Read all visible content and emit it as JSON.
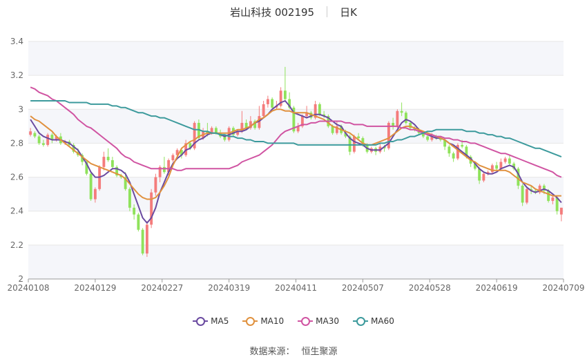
{
  "header": {
    "title": "岩山科技 002195",
    "period": "日K"
  },
  "source": {
    "label": "数据来源：",
    "name": "恒生聚源"
  },
  "colors": {
    "up": "#f47c7c",
    "down": "#8fe25b",
    "band": "#f5f6fa",
    "grid": "#e6e6e6",
    "ma5": "#6a4aa0",
    "ma10": "#e0913e",
    "ma30": "#d054a2",
    "ma60": "#3c9a9c"
  },
  "chart_data": {
    "type": "candlestick",
    "title": "岩山科技 002195",
    "ylim": [
      2,
      3.4
    ],
    "y_ticks": [
      "2",
      "2.2",
      "2.4",
      "2.6",
      "2.8",
      "3",
      "3.2",
      "3.4"
    ],
    "x_ticks": [
      "20240108",
      "20240129",
      "20240227",
      "20240319",
      "20240411",
      "20240507",
      "20240528",
      "20240619",
      "20240709"
    ],
    "n_days": 124,
    "candles": [
      [
        2.85,
        2.87,
        2.84,
        2.89
      ],
      [
        2.86,
        2.84,
        2.83,
        2.87
      ],
      [
        2.84,
        2.8,
        2.79,
        2.85
      ],
      [
        2.8,
        2.79,
        2.78,
        2.82
      ],
      [
        2.79,
        2.85,
        2.78,
        2.86
      ],
      [
        2.85,
        2.82,
        2.8,
        2.86
      ],
      [
        2.82,
        2.84,
        2.81,
        2.85
      ],
      [
        2.84,
        2.8,
        2.79,
        2.86
      ],
      [
        2.8,
        2.81,
        2.79,
        2.82
      ],
      [
        2.81,
        2.79,
        2.78,
        2.82
      ],
      [
        2.79,
        2.75,
        2.74,
        2.8
      ],
      [
        2.75,
        2.73,
        2.72,
        2.77
      ],
      [
        2.73,
        2.69,
        2.67,
        2.74
      ],
      [
        2.69,
        2.62,
        2.61,
        2.7
      ],
      [
        2.62,
        2.47,
        2.46,
        2.63
      ],
      [
        2.47,
        2.53,
        2.45,
        2.54
      ],
      [
        2.53,
        2.66,
        2.52,
        2.67
      ],
      [
        2.66,
        2.72,
        2.64,
        2.75
      ],
      [
        2.72,
        2.7,
        2.69,
        2.77
      ],
      [
        2.7,
        2.66,
        2.65,
        2.72
      ],
      [
        2.66,
        2.61,
        2.6,
        2.67
      ],
      [
        2.61,
        2.6,
        2.59,
        2.62
      ],
      [
        2.6,
        2.53,
        2.52,
        2.63
      ],
      [
        2.53,
        2.42,
        2.4,
        2.54
      ],
      [
        2.42,
        2.38,
        2.35,
        2.44
      ],
      [
        2.38,
        2.29,
        2.28,
        2.39
      ],
      [
        2.29,
        2.15,
        2.14,
        2.3
      ],
      [
        2.15,
        2.32,
        2.13,
        2.34
      ],
      [
        2.32,
        2.51,
        2.3,
        2.53
      ],
      [
        2.51,
        2.6,
        2.49,
        2.62
      ],
      [
        2.6,
        2.66,
        2.57,
        2.67
      ],
      [
        2.66,
        2.63,
        2.62,
        2.72
      ],
      [
        2.63,
        2.7,
        2.61,
        2.71
      ],
      [
        2.7,
        2.73,
        2.69,
        2.74
      ],
      [
        2.73,
        2.76,
        2.72,
        2.77
      ],
      [
        2.76,
        2.73,
        2.71,
        2.77
      ],
      [
        2.73,
        2.8,
        2.72,
        2.82
      ],
      [
        2.8,
        2.77,
        2.76,
        2.81
      ],
      [
        2.77,
        2.92,
        2.76,
        2.93
      ],
      [
        2.92,
        2.83,
        2.82,
        2.94
      ],
      [
        2.83,
        2.87,
        2.82,
        2.89
      ],
      [
        2.87,
        2.86,
        2.84,
        2.92
      ],
      [
        2.86,
        2.89,
        2.85,
        2.9
      ],
      [
        2.89,
        2.86,
        2.85,
        2.9
      ],
      [
        2.86,
        2.84,
        2.83,
        2.88
      ],
      [
        2.84,
        2.82,
        2.81,
        2.85
      ],
      [
        2.82,
        2.89,
        2.81,
        2.9
      ],
      [
        2.89,
        2.85,
        2.84,
        2.9
      ],
      [
        2.85,
        2.87,
        2.84,
        2.88
      ],
      [
        2.87,
        2.92,
        2.86,
        2.99
      ],
      [
        2.92,
        2.89,
        2.88,
        2.94
      ],
      [
        2.89,
        2.93,
        2.88,
        2.96
      ],
      [
        2.93,
        2.89,
        2.88,
        2.94
      ],
      [
        2.89,
        2.96,
        2.88,
        3.02
      ],
      [
        2.96,
        3.03,
        2.95,
        3.05
      ],
      [
        3.03,
        3.06,
        3.01,
        3.08
      ],
      [
        3.06,
        3.01,
        3,
        3.07
      ],
      [
        3.01,
        3.02,
        3,
        3.05
      ],
      [
        3.02,
        3.11,
        3.01,
        3.13
      ],
      [
        3.11,
        3.06,
        3.05,
        3.25
      ],
      [
        3.06,
        3.01,
        3,
        3.1
      ],
      [
        3.01,
        2.87,
        2.86,
        3.02
      ],
      [
        2.87,
        2.9,
        2.86,
        2.92
      ],
      [
        2.9,
        2.96,
        2.89,
        2.97
      ],
      [
        2.96,
        2.98,
        2.95,
        3.02
      ],
      [
        2.98,
        2.95,
        2.94,
        2.99
      ],
      [
        2.95,
        3.03,
        2.94,
        3.05
      ],
      [
        3.03,
        2.97,
        2.96,
        3.04
      ],
      [
        2.97,
        2.96,
        2.95,
        2.99
      ],
      [
        2.96,
        2.9,
        2.89,
        2.97
      ],
      [
        2.9,
        2.86,
        2.85,
        2.91
      ],
      [
        2.86,
        2.9,
        2.85,
        2.93
      ],
      [
        2.9,
        2.86,
        2.85,
        2.91
      ],
      [
        2.86,
        2.84,
        2.83,
        2.88
      ],
      [
        2.84,
        2.75,
        2.73,
        2.85
      ],
      [
        2.75,
        2.84,
        2.74,
        2.85
      ],
      [
        2.84,
        2.83,
        2.82,
        2.86
      ],
      [
        2.83,
        2.79,
        2.78,
        2.84
      ],
      [
        2.79,
        2.75,
        2.74,
        2.8
      ],
      [
        2.75,
        2.77,
        2.74,
        2.78
      ],
      [
        2.77,
        2.75,
        2.73,
        2.78
      ],
      [
        2.75,
        2.78,
        2.74,
        2.8
      ],
      [
        2.78,
        2.77,
        2.75,
        2.79
      ],
      [
        2.77,
        2.92,
        2.76,
        2.93
      ],
      [
        2.92,
        2.9,
        2.88,
        2.95
      ],
      [
        2.9,
        2.99,
        2.89,
        3
      ],
      [
        2.99,
        2.98,
        2.96,
        3.04
      ],
      [
        2.98,
        2.92,
        2.91,
        2.99
      ],
      [
        2.92,
        2.89,
        2.88,
        2.93
      ],
      [
        2.89,
        2.88,
        2.87,
        2.9
      ],
      [
        2.88,
        2.86,
        2.85,
        2.89
      ],
      [
        2.86,
        2.84,
        2.83,
        2.87
      ],
      [
        2.84,
        2.82,
        2.81,
        2.85
      ],
      [
        2.82,
        2.84,
        2.81,
        2.86
      ],
      [
        2.84,
        2.83,
        2.82,
        2.85
      ],
      [
        2.83,
        2.82,
        2.81,
        2.84
      ],
      [
        2.82,
        2.78,
        2.76,
        2.83
      ],
      [
        2.78,
        2.74,
        2.72,
        2.79
      ],
      [
        2.74,
        2.71,
        2.69,
        2.75
      ],
      [
        2.71,
        2.79,
        2.7,
        2.8
      ],
      [
        2.79,
        2.78,
        2.77,
        2.82
      ],
      [
        2.78,
        2.72,
        2.71,
        2.79
      ],
      [
        2.72,
        2.68,
        2.66,
        2.73
      ],
      [
        2.68,
        2.65,
        2.64,
        2.69
      ],
      [
        2.65,
        2.58,
        2.56,
        2.66
      ],
      [
        2.58,
        2.62,
        2.57,
        2.63
      ],
      [
        2.62,
        2.63,
        2.61,
        2.64
      ],
      [
        2.63,
        2.67,
        2.62,
        2.68
      ],
      [
        2.67,
        2.65,
        2.64,
        2.69
      ],
      [
        2.65,
        2.69,
        2.64,
        2.71
      ],
      [
        2.69,
        2.71,
        2.68,
        2.72
      ],
      [
        2.71,
        2.68,
        2.67,
        2.73
      ],
      [
        2.68,
        2.65,
        2.64,
        2.69
      ],
      [
        2.65,
        2.55,
        2.53,
        2.66
      ],
      [
        2.55,
        2.45,
        2.43,
        2.56
      ],
      [
        2.45,
        2.53,
        2.44,
        2.54
      ],
      [
        2.53,
        2.52,
        2.5,
        2.55
      ],
      [
        2.52,
        2.51,
        2.5,
        2.53
      ],
      [
        2.51,
        2.55,
        2.5,
        2.56
      ],
      [
        2.55,
        2.52,
        2.5,
        2.56
      ],
      [
        2.52,
        2.46,
        2.45,
        2.53
      ],
      [
        2.46,
        2.48,
        2.44,
        2.49
      ],
      [
        2.48,
        2.4,
        2.38,
        2.49
      ],
      [
        2.38,
        2.42,
        2.34,
        2.42
      ]
    ],
    "ma_series": [
      {
        "name": "MA5",
        "values": [
          2.94,
          2.9,
          2.86,
          2.84,
          2.83,
          2.82,
          2.82,
          2.82,
          2.81,
          2.8,
          2.78,
          2.76,
          2.72,
          2.68,
          2.63,
          2.6,
          2.6,
          2.61,
          2.63,
          2.65,
          2.65,
          2.64,
          2.62,
          2.57,
          2.5,
          2.43,
          2.36,
          2.33,
          2.36,
          2.42,
          2.51,
          2.57,
          2.63,
          2.68,
          2.71,
          2.73,
          2.76,
          2.77,
          2.8,
          2.82,
          2.83,
          2.85,
          2.86,
          2.86,
          2.85,
          2.84,
          2.85,
          2.86,
          2.87,
          2.87,
          2.88,
          2.9,
          2.92,
          2.93,
          2.95,
          2.97,
          3,
          3.02,
          3.04,
          3.05,
          3.02,
          2.98,
          2.97,
          2.96,
          2.95,
          2.96,
          2.97,
          2.97,
          2.96,
          2.95,
          2.93,
          2.91,
          2.9,
          2.86,
          2.83,
          2.81,
          2.8,
          2.79,
          2.77,
          2.76,
          2.76,
          2.76,
          2.78,
          2.8,
          2.84,
          2.88,
          2.92,
          2.94,
          2.93,
          2.91,
          2.88,
          2.86,
          2.85,
          2.84,
          2.83,
          2.83,
          2.82,
          2.8,
          2.79,
          2.77,
          2.75,
          2.73,
          2.71,
          2.68,
          2.65,
          2.63,
          2.62,
          2.62,
          2.63,
          2.65,
          2.66,
          2.67,
          2.66,
          2.62,
          2.57,
          2.54,
          2.52,
          2.51,
          2.52,
          2.53,
          2.52,
          2.5,
          2.48,
          2.45
        ]
      },
      {
        "name": "MA10",
        "values": [
          2.96,
          2.94,
          2.93,
          2.91,
          2.89,
          2.87,
          2.84,
          2.82,
          2.8,
          2.78,
          2.76,
          2.74,
          2.72,
          2.7,
          2.68,
          2.67,
          2.66,
          2.65,
          2.64,
          2.63,
          2.62,
          2.61,
          2.59,
          2.56,
          2.53,
          2.5,
          2.48,
          2.47,
          2.47,
          2.48,
          2.51,
          2.55,
          2.6,
          2.67,
          2.72,
          2.77,
          2.79,
          2.81,
          2.82,
          2.84,
          2.85,
          2.86,
          2.86,
          2.86,
          2.86,
          2.86,
          2.86,
          2.87,
          2.88,
          2.88,
          2.89,
          2.9,
          2.92,
          2.94,
          2.95,
          2.97,
          2.99,
          3,
          3,
          2.99,
          2.99,
          2.98,
          2.98,
          2.98,
          2.98,
          2.97,
          2.96,
          2.95,
          2.94,
          2.92,
          2.9,
          2.89,
          2.88,
          2.87,
          2.86,
          2.84,
          2.82,
          2.8,
          2.79,
          2.79,
          2.8,
          2.81,
          2.82,
          2.83,
          2.85,
          2.87,
          2.89,
          2.9,
          2.9,
          2.89,
          2.88,
          2.87,
          2.86,
          2.85,
          2.84,
          2.83,
          2.82,
          2.8,
          2.78,
          2.76,
          2.74,
          2.72,
          2.7,
          2.69,
          2.67,
          2.66,
          2.65,
          2.64,
          2.64,
          2.64,
          2.64,
          2.63,
          2.61,
          2.59,
          2.57,
          2.56,
          2.55,
          2.53,
          2.52,
          2.51,
          2.5,
          2.49,
          2.49,
          2.49
        ]
      },
      {
        "name": "MA30",
        "values": [
          3.13,
          3.12,
          3.1,
          3.09,
          3.08,
          3.06,
          3.05,
          3.03,
          3.01,
          2.99,
          2.97,
          2.94,
          2.92,
          2.9,
          2.89,
          2.87,
          2.85,
          2.83,
          2.81,
          2.79,
          2.77,
          2.74,
          2.72,
          2.71,
          2.69,
          2.68,
          2.67,
          2.66,
          2.65,
          2.65,
          2.65,
          2.65,
          2.65,
          2.65,
          2.64,
          2.64,
          2.65,
          2.65,
          2.65,
          2.65,
          2.65,
          2.65,
          2.65,
          2.65,
          2.65,
          2.65,
          2.65,
          2.66,
          2.67,
          2.69,
          2.7,
          2.71,
          2.72,
          2.73,
          2.75,
          2.77,
          2.79,
          2.82,
          2.85,
          2.87,
          2.88,
          2.89,
          2.9,
          2.91,
          2.91,
          2.92,
          2.92,
          2.93,
          2.93,
          2.93,
          2.93,
          2.93,
          2.93,
          2.92,
          2.92,
          2.91,
          2.91,
          2.91,
          2.9,
          2.9,
          2.9,
          2.9,
          2.9,
          2.9,
          2.9,
          2.9,
          2.89,
          2.89,
          2.88,
          2.88,
          2.87,
          2.86,
          2.85,
          2.85,
          2.84,
          2.84,
          2.83,
          2.83,
          2.82,
          2.82,
          2.81,
          2.81,
          2.8,
          2.8,
          2.79,
          2.78,
          2.77,
          2.76,
          2.75,
          2.74,
          2.74,
          2.73,
          2.72,
          2.71,
          2.7,
          2.69,
          2.68,
          2.67,
          2.66,
          2.65,
          2.64,
          2.63,
          2.61,
          2.6
        ]
      },
      {
        "name": "MA60",
        "values": [
          3.05,
          3.05,
          3.05,
          3.05,
          3.05,
          3.05,
          3.05,
          3.05,
          3.05,
          3.04,
          3.04,
          3.04,
          3.04,
          3.04,
          3.03,
          3.03,
          3.03,
          3.03,
          3.03,
          3.02,
          3.02,
          3.01,
          3.01,
          3,
          2.99,
          2.98,
          2.98,
          2.97,
          2.96,
          2.96,
          2.95,
          2.95,
          2.94,
          2.93,
          2.92,
          2.91,
          2.9,
          2.89,
          2.88,
          2.88,
          2.87,
          2.87,
          2.86,
          2.86,
          2.85,
          2.85,
          2.84,
          2.84,
          2.83,
          2.83,
          2.82,
          2.82,
          2.81,
          2.81,
          2.81,
          2.8,
          2.8,
          2.8,
          2.8,
          2.8,
          2.8,
          2.8,
          2.79,
          2.79,
          2.79,
          2.79,
          2.79,
          2.79,
          2.79,
          2.79,
          2.79,
          2.79,
          2.79,
          2.79,
          2.79,
          2.79,
          2.79,
          2.79,
          2.79,
          2.79,
          2.79,
          2.8,
          2.8,
          2.81,
          2.81,
          2.82,
          2.82,
          2.83,
          2.84,
          2.84,
          2.85,
          2.86,
          2.87,
          2.87,
          2.88,
          2.88,
          2.88,
          2.88,
          2.88,
          2.88,
          2.88,
          2.87,
          2.87,
          2.87,
          2.86,
          2.86,
          2.85,
          2.85,
          2.84,
          2.84,
          2.83,
          2.83,
          2.82,
          2.81,
          2.8,
          2.79,
          2.78,
          2.77,
          2.77,
          2.76,
          2.75,
          2.74,
          2.73,
          2.72
        ]
      }
    ],
    "legend": [
      "MA5",
      "MA10",
      "MA30",
      "MA60"
    ],
    "legend_position": "bottom",
    "grid": true
  }
}
